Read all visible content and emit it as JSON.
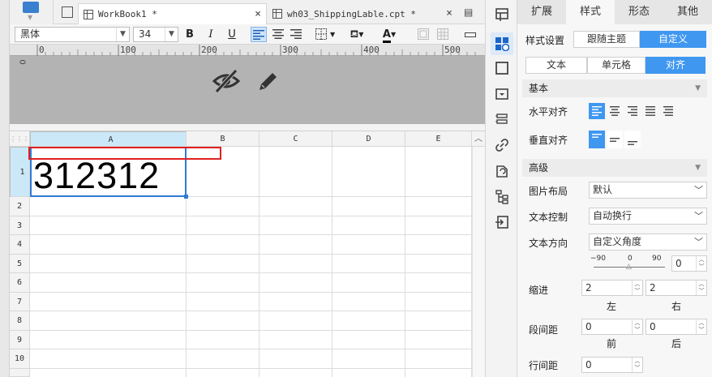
{
  "tabs": [
    {
      "label": "WorkBook1 *",
      "close": "×"
    },
    {
      "label": "wh03_ShippingLable.cpt *",
      "close": "×"
    }
  ],
  "toolbar": {
    "font": "黑体",
    "size": "34",
    "bold": "B",
    "italic": "I",
    "underline": "U",
    "textcolor_letter": "A"
  },
  "ruler": {
    "zero": "0",
    "marks": [
      "100",
      "200",
      "300",
      "400",
      "500"
    ]
  },
  "grid": {
    "columns": [
      "A",
      "B",
      "C",
      "D",
      "E"
    ],
    "rows": [
      "1",
      "2",
      "3",
      "4",
      "5",
      "6",
      "7",
      "8",
      "9",
      "10"
    ],
    "cell_a1": "312312"
  },
  "panel": {
    "tabs": [
      "扩展",
      "样式",
      "形态",
      "其他"
    ],
    "style_setting_label": "样式设置",
    "style_options": [
      "跟随主题",
      "自定义"
    ],
    "sub_tabs": [
      "文本",
      "单元格",
      "对齐"
    ],
    "basic": "基本",
    "h_align_label": "水平对齐",
    "v_align_label": "垂直对齐",
    "advanced": "高级",
    "image_layout_label": "图片布局",
    "image_layout_value": "默认",
    "text_control_label": "文本控制",
    "text_control_value": "自动换行",
    "text_direction_label": "文本方向",
    "text_direction_value": "自定义角度",
    "angle_min": "−90",
    "angle_mid": "0",
    "angle_max": "90",
    "angle_value": "0",
    "indent_label": "缩进",
    "indent_left": "2",
    "indent_right": "2",
    "left": "左",
    "right": "右",
    "para_label": "段间距",
    "para_before": "0",
    "para_after": "0",
    "before": "前",
    "after": "后",
    "line_label": "行间距",
    "line_value": "0"
  }
}
